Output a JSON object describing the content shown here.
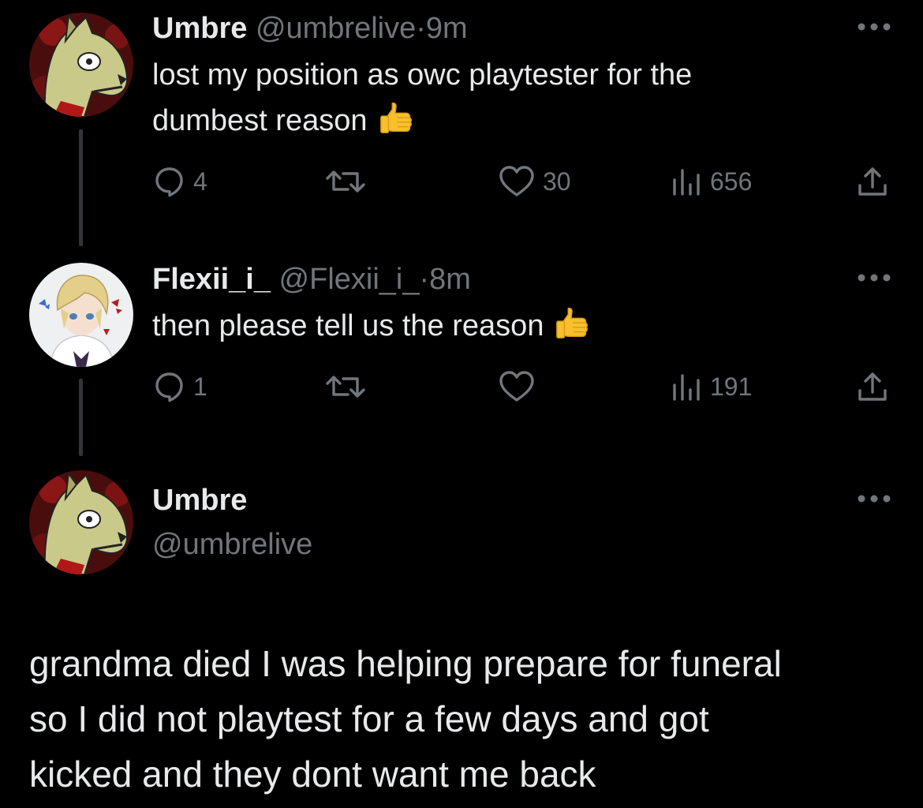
{
  "tweets": [
    {
      "display_name": "Umbre",
      "handle": "@umbrelive",
      "separator": "·",
      "time": "9m",
      "text_lines": [
        "lost my position as owc playtester for the",
        "dumbest reason"
      ],
      "avatar_icon": "wolf-avatar-icon",
      "replies": "4",
      "retweets": "",
      "likes": "30",
      "views": "656"
    },
    {
      "display_name": "Flexii_i_",
      "handle": "@Flexii_i_",
      "separator": "·",
      "time": "8m",
      "text_lines": [
        "then please tell us the reason"
      ],
      "avatar_icon": "anime-boy-avatar-icon",
      "replies": "1",
      "retweets": "",
      "likes": "",
      "views": "191"
    }
  ],
  "focused_tweet": {
    "display_name": "Umbre",
    "handle": "@umbrelive",
    "avatar_icon": "wolf-avatar-icon",
    "text_lines": [
      "grandma died I was helping prepare for funeral",
      "so I did not playtest for a few days and got",
      "kicked and they dont want me back"
    ]
  },
  "colors": {
    "background": "#000000",
    "text": "#e7e9ea",
    "secondary": "#71767b",
    "thread_line": "#333639",
    "emoji": "#f7c02c"
  }
}
